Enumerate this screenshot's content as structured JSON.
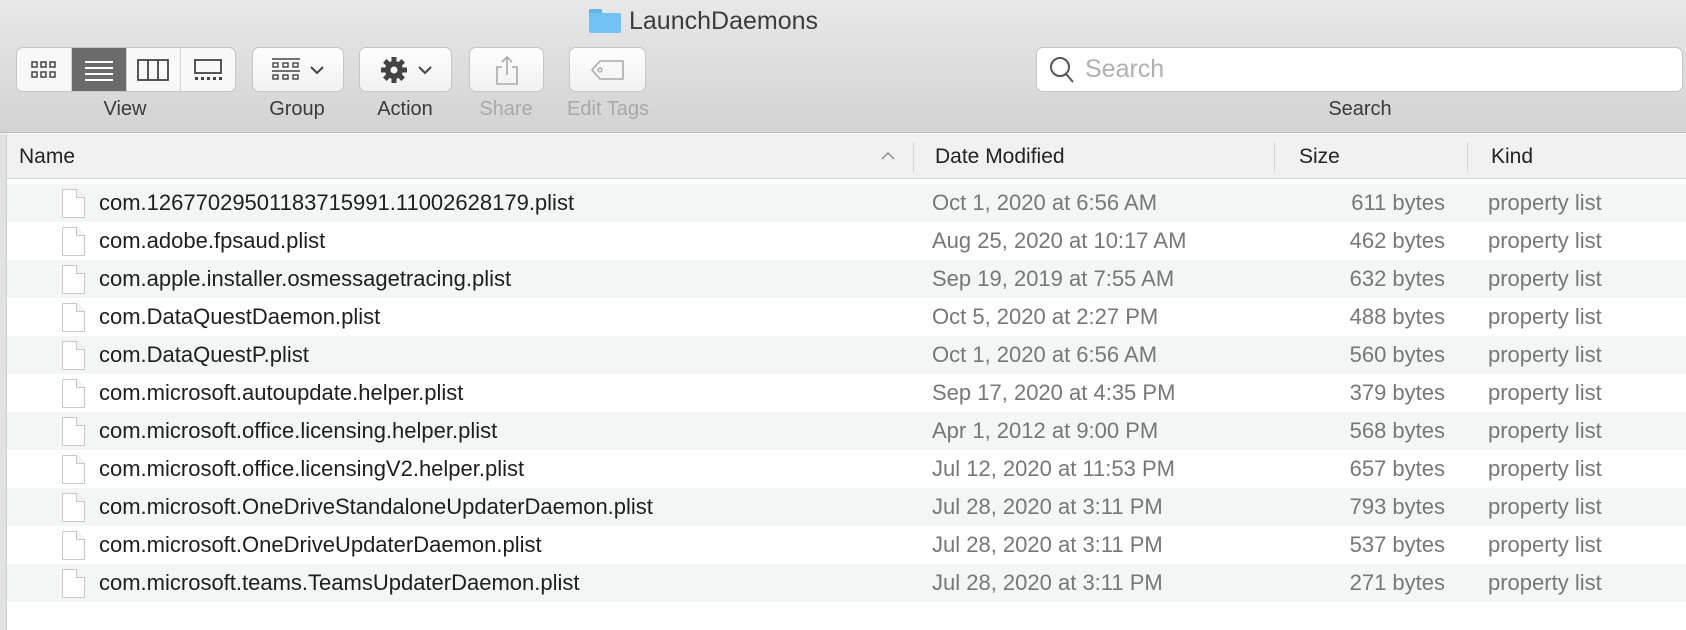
{
  "window": {
    "title": "LaunchDaemons"
  },
  "toolbar": {
    "view_label": "View",
    "group_label": "Group",
    "action_label": "Action",
    "share_label": "Share",
    "edit_tags_label": "Edit Tags",
    "search_label": "Search",
    "search_placeholder": "Search",
    "search_value": "",
    "active_view": "list"
  },
  "columns": {
    "name": "Name",
    "date": "Date Modified",
    "size": "Size",
    "kind": "Kind",
    "sort": "Name ascending"
  },
  "files": [
    {
      "name": "com.12677029501183715991.11002628179.plist",
      "date": "Oct 1, 2020 at 6:56 AM",
      "size": "611 bytes",
      "kind": "property list"
    },
    {
      "name": "com.adobe.fpsaud.plist",
      "date": "Aug 25, 2020 at 10:17 AM",
      "size": "462 bytes",
      "kind": "property list"
    },
    {
      "name": "com.apple.installer.osmessagetracing.plist",
      "date": "Sep 19, 2019 at 7:55 AM",
      "size": "632 bytes",
      "kind": "property list"
    },
    {
      "name": "com.DataQuestDaemon.plist",
      "date": "Oct 5, 2020 at 2:27 PM",
      "size": "488 bytes",
      "kind": "property list"
    },
    {
      "name": "com.DataQuestP.plist",
      "date": "Oct 1, 2020 at 6:56 AM",
      "size": "560 bytes",
      "kind": "property list"
    },
    {
      "name": "com.microsoft.autoupdate.helper.plist",
      "date": "Sep 17, 2020 at 4:35 PM",
      "size": "379 bytes",
      "kind": "property list"
    },
    {
      "name": "com.microsoft.office.licensing.helper.plist",
      "date": "Apr 1, 2012 at 9:00 PM",
      "size": "568 bytes",
      "kind": "property list"
    },
    {
      "name": "com.microsoft.office.licensingV2.helper.plist",
      "date": "Jul 12, 2020 at 11:53 PM",
      "size": "657 bytes",
      "kind": "property list"
    },
    {
      "name": "com.microsoft.OneDriveStandaloneUpdaterDaemon.plist",
      "date": "Jul 28, 2020 at 3:11 PM",
      "size": "793 bytes",
      "kind": "property list"
    },
    {
      "name": "com.microsoft.OneDriveUpdaterDaemon.plist",
      "date": "Jul 28, 2020 at 3:11 PM",
      "size": "537 bytes",
      "kind": "property list"
    },
    {
      "name": "com.microsoft.teams.TeamsUpdaterDaemon.plist",
      "date": "Jul 28, 2020 at 3:11 PM",
      "size": "271 bytes",
      "kind": "property list"
    }
  ]
}
